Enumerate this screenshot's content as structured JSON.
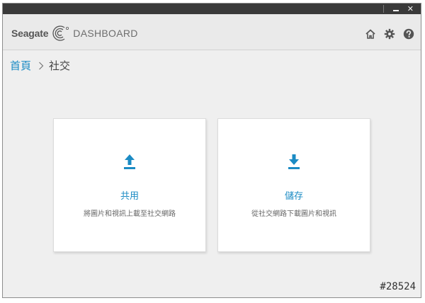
{
  "titlebar": {
    "minimize_icon": "minimize-icon",
    "close_icon": "close-icon",
    "close_label": "✕"
  },
  "brand": {
    "name": "Seagate",
    "product": "DASHBOARD"
  },
  "header": {
    "icons": [
      "home-icon",
      "gear-icon",
      "help-icon"
    ]
  },
  "breadcrumb": {
    "home": "首頁",
    "current": "社交"
  },
  "cards": [
    {
      "title": "共用",
      "description": "將圖片和視訊上載至社交網路",
      "icon": "upload-icon"
    },
    {
      "title": "儲存",
      "description": "從社交網路下載圖片和視訊",
      "icon": "download-icon"
    }
  ],
  "footer": {
    "id": "#28524"
  },
  "colors": {
    "accent": "#1b8bc4",
    "titlebar": "#3a3a3a",
    "background": "#efefef",
    "header": "#eaeaea",
    "card": "#ffffff"
  }
}
